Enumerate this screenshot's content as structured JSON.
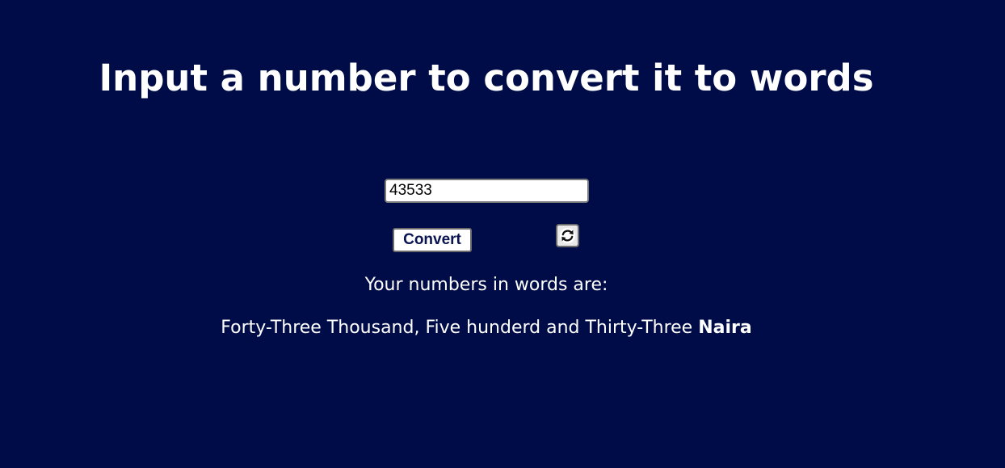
{
  "page": {
    "heading": "Input a number to convert it to words",
    "background_color": "#000c48",
    "text_color": "#ffffff"
  },
  "form": {
    "number_input_value": "43533",
    "convert_label": "Convert",
    "refresh_icon": "refresh-icon"
  },
  "result": {
    "label": "Your numbers in words are:",
    "words": "Forty-Three Thousand, Five hunderd and Thirty-Three",
    "currency": "Naira"
  }
}
